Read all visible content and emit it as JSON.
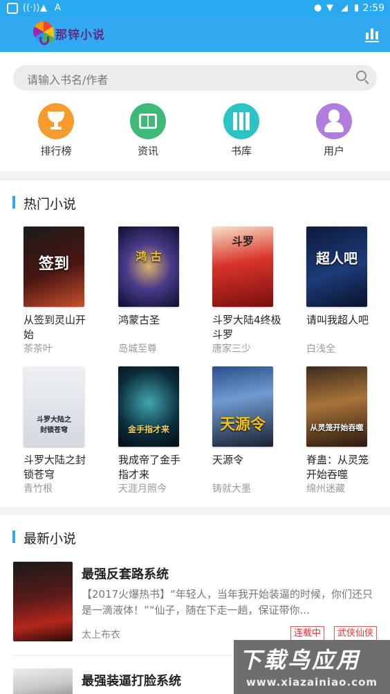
{
  "status_bar": {
    "time": "2:59"
  },
  "header": {
    "brand": "那锌小说",
    "tagline": "",
    "rank_icon": "bar-chart-icon"
  },
  "search": {
    "placeholder": "请输入书名/作者"
  },
  "categories": [
    {
      "label": "排行榜",
      "icon": "trophy-icon",
      "color": "#f79b2c"
    },
    {
      "label": "资讯",
      "icon": "book-open-icon",
      "color": "#3dbb76"
    },
    {
      "label": "书库",
      "icon": "bookshelf-icon",
      "color": "#2cc3c5"
    },
    {
      "label": "用户",
      "icon": "user-icon",
      "color": "#b07ce0"
    }
  ],
  "hot": {
    "title": "热门小说",
    "books": [
      {
        "title": "从签到灵山开始",
        "author": "茶茶叶"
      },
      {
        "title": "鸿蒙古圣",
        "author": "岛城至尊"
      },
      {
        "title": "斗罗大陆4终极斗罗",
        "author": "唐家三少"
      },
      {
        "title": "请叫我超人吧",
        "author": "白浅全"
      },
      {
        "title": "斗罗大陆之封锁苍穹",
        "author": "青竹根"
      },
      {
        "title": "我成帝了金手指才来",
        "author": "天涯月照今"
      },
      {
        "title": "天源令",
        "author": "铸就大墨"
      },
      {
        "title": "脊蛊：从灵笼开始吞噬",
        "author": "绵州迷藏"
      }
    ]
  },
  "latest": {
    "title": "最新小说",
    "items": [
      {
        "title": "最强反套路系统",
        "desc": "【2017火爆热书】“年轻人，当年我开始装逼的时候，你们还只是一滴液体！”“仙子，随在下走一趟，保证带你...",
        "author": "太上布衣",
        "tags": [
          "连载中",
          "武侠仙侠"
        ]
      },
      {
        "title": "最强装逼打脸系统"
      }
    ]
  },
  "watermark": {
    "main": "下载鸟应用",
    "url": "www.xiazainiao.com"
  }
}
